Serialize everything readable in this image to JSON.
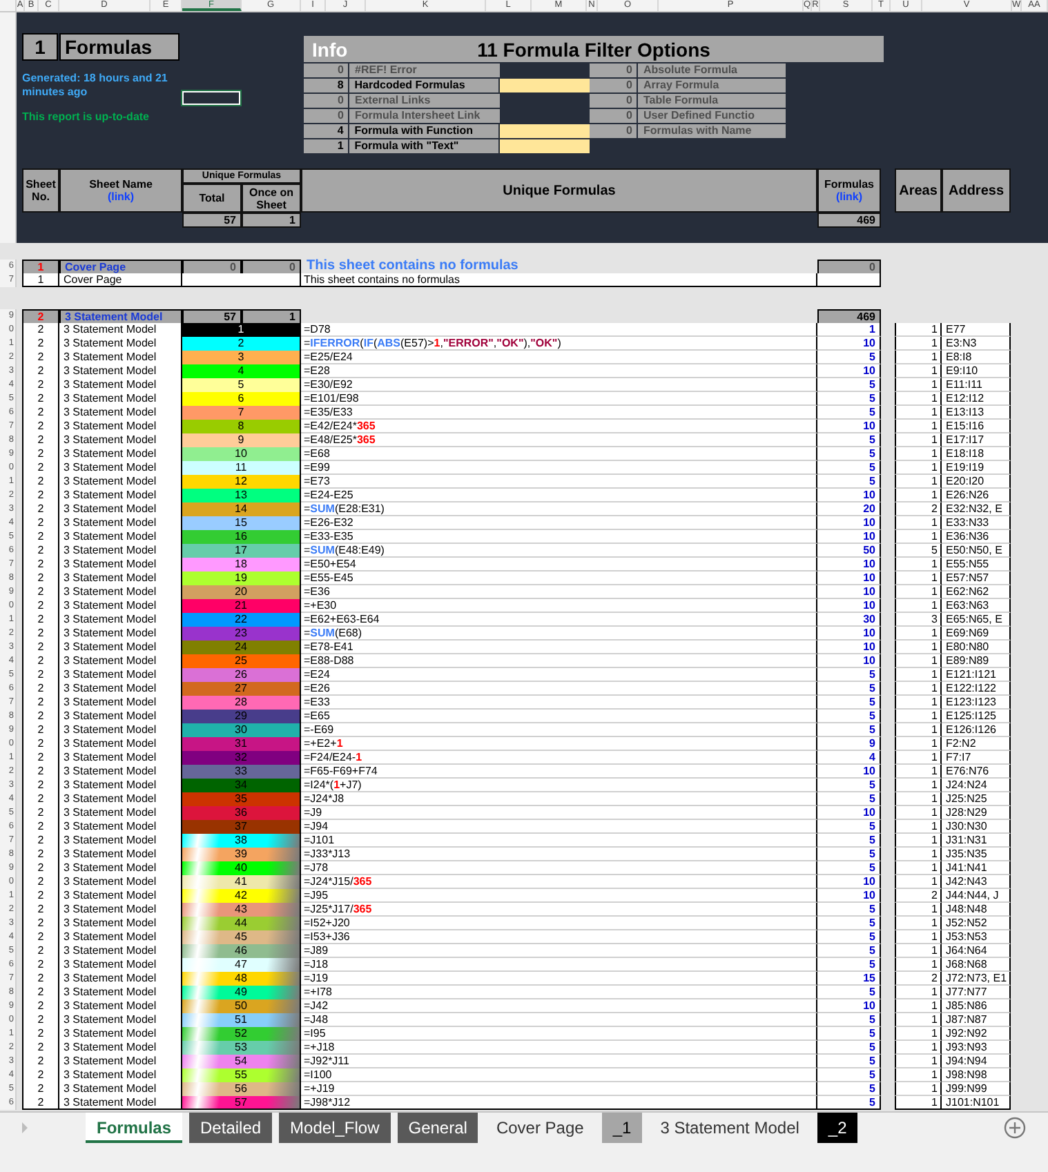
{
  "column_headers": [
    {
      "label": "A",
      "selected": false
    },
    {
      "label": "B",
      "selected": false
    },
    {
      "label": "C",
      "selected": false
    },
    {
      "label": "D",
      "selected": false
    },
    {
      "label": "E",
      "selected": false
    },
    {
      "label": "F",
      "selected": true
    },
    {
      "label": "G",
      "selected": false
    },
    {
      "label": "I",
      "selected": false
    },
    {
      "label": "J",
      "selected": false
    },
    {
      "label": "K",
      "selected": false
    },
    {
      "label": "L",
      "selected": false
    },
    {
      "label": "M",
      "selected": false
    },
    {
      "label": "N",
      "selected": false
    },
    {
      "label": "O",
      "selected": false
    },
    {
      "label": "P",
      "selected": false
    },
    {
      "label": "Q",
      "selected": false
    },
    {
      "label": "R",
      "selected": false
    },
    {
      "label": "S",
      "selected": false
    },
    {
      "label": "T",
      "selected": false
    },
    {
      "label": "U",
      "selected": false
    },
    {
      "label": "V",
      "selected": false
    },
    {
      "label": "W",
      "selected": false
    },
    {
      "label": "AA",
      "selected": false
    }
  ],
  "title": {
    "number": "1",
    "name": "Formulas"
  },
  "generated": "Generated: 18 hours and 21 minutes ago",
  "status": "This report is up-to-date",
  "info": {
    "label": "Info",
    "title": "11 Formula Filter Options",
    "left_filters": [
      {
        "count": "0",
        "label": "#REF! Error",
        "disabled": true
      },
      {
        "count": "8",
        "label": "Hardcoded Formulas",
        "disabled": false
      },
      {
        "count": "0",
        "label": "External Links",
        "disabled": true
      },
      {
        "count": "0",
        "label": "Formula Intersheet Link",
        "disabled": true
      },
      {
        "count": "4",
        "label": "Formula with Function",
        "disabled": false
      },
      {
        "count": "1",
        "label": "Formula with \"Text\"",
        "disabled": false
      }
    ],
    "right_filters": [
      {
        "count": "0",
        "label": "Absolute Formula",
        "disabled": true
      },
      {
        "count": "0",
        "label": "Array Formula",
        "disabled": true
      },
      {
        "count": "0",
        "label": "Table Formula",
        "disabled": true
      },
      {
        "count": "0",
        "label": "User Defined Functio",
        "disabled": true
      },
      {
        "count": "0",
        "label": "Formulas with Name",
        "disabled": true
      }
    ]
  },
  "summary": {
    "sheet_no": "Sheet No.",
    "sheet_name": "Sheet Name",
    "sheet_link": "(link)",
    "unique_group": "Unique Formulas",
    "total": "Total",
    "once": "Once on Sheet",
    "unique": "Unique Formulas",
    "formulas": "Formulas",
    "formulas_link": "(link)",
    "areas": "Areas",
    "address": "Address",
    "total_value": "57",
    "once_value": "1",
    "formulas_value": "469"
  },
  "sheets": [
    {
      "row": "6",
      "number": "1",
      "name": "Cover Page",
      "total": "0",
      "once": "0",
      "has_formulas": false,
      "note": "This sheet contains no formulas",
      "formulas": "0",
      "rows": [
        {
          "row": "7",
          "number": "1",
          "name": "Cover Page",
          "formula": "This sheet contains no formulas"
        }
      ]
    },
    {
      "row": "9",
      "number": "2",
      "name": "3 Statement Model",
      "total": "57",
      "once": "1",
      "has_formulas": true,
      "formulas": "469",
      "rows": [
        {
          "row": "0",
          "number": "2",
          "name": "3 Statement Model",
          "index": "1",
          "color": "#000000",
          "kind": "solid",
          "formula": "=D78",
          "formulas": "1",
          "areas": "1",
          "address": "E77"
        },
        {
          "row": "1",
          "number": "2",
          "name": "3 Statement Model",
          "index": "2",
          "color": "#00ffff",
          "kind": "solid",
          "formula": [
            {
              "text": "=",
              "kind": "text"
            },
            {
              "text": "IFERROR",
              "kind": "function"
            },
            {
              "text": "(",
              "kind": "text"
            },
            {
              "text": "IF",
              "kind": "function"
            },
            {
              "text": "(",
              "kind": "text"
            },
            {
              "text": "ABS",
              "kind": "function"
            },
            {
              "text": "(E57)>",
              "kind": "text"
            },
            {
              "text": "1",
              "kind": "number"
            },
            {
              "text": ",",
              "kind": "text"
            },
            {
              "text": "\"ERROR\"",
              "kind": "string"
            },
            {
              "text": ",",
              "kind": "text"
            },
            {
              "text": "\"OK\"",
              "kind": "string"
            },
            {
              "text": "),",
              "kind": "text"
            },
            {
              "text": "\"OK\"",
              "kind": "string"
            },
            {
              "text": ")",
              "kind": "text"
            }
          ],
          "formulas": "10",
          "areas": "1",
          "address": "E3:N3"
        },
        {
          "row": "2",
          "number": "2",
          "name": "3 Statement Model",
          "index": "3",
          "color": "#ffb04f",
          "kind": "solid",
          "formula": "=E25/E24",
          "formulas": "5",
          "areas": "1",
          "address": "E8:I8"
        },
        {
          "row": "3",
          "number": "2",
          "name": "3 Statement Model",
          "index": "4",
          "color": "#00ff00",
          "kind": "solid",
          "formula": "=E28",
          "formulas": "10",
          "areas": "1",
          "address": "E9:I10"
        },
        {
          "row": "4",
          "number": "2",
          "name": "3 Statement Model",
          "index": "5",
          "color": "#ffff99",
          "kind": "solid",
          "formula": "=E30/E92",
          "formulas": "5",
          "areas": "1",
          "address": "E11:I11"
        },
        {
          "row": "5",
          "number": "2",
          "name": "3 Statement Model",
          "index": "6",
          "color": "#ffff00",
          "kind": "solid",
          "formula": "=E101/E98",
          "formulas": "5",
          "areas": "1",
          "address": "E12:I12"
        },
        {
          "row": "6",
          "number": "2",
          "name": "3 Statement Model",
          "index": "7",
          "color": "#ff9966",
          "kind": "solid",
          "formula": "=E35/E33",
          "formulas": "5",
          "areas": "1",
          "address": "E13:I13"
        },
        {
          "row": "7",
          "number": "2",
          "name": "3 Statement Model",
          "index": "8",
          "color": "#99cc00",
          "kind": "solid",
          "formula": [
            {
              "text": "=E42/E24*",
              "kind": "text"
            },
            {
              "text": "365",
              "kind": "number"
            }
          ],
          "formulas": "10",
          "areas": "1",
          "address": "E15:I16"
        },
        {
          "row": "8",
          "number": "2",
          "name": "3 Statement Model",
          "index": "9",
          "color": "#ffcc99",
          "kind": "solid",
          "formula": [
            {
              "text": "=E48/E25*",
              "kind": "text"
            },
            {
              "text": "365",
              "kind": "number"
            }
          ],
          "formulas": "5",
          "areas": "1",
          "address": "E17:I17"
        },
        {
          "row": "9",
          "number": "2",
          "name": "3 Statement Model",
          "index": "10",
          "color": "#90ee90",
          "kind": "solid",
          "formula": "=E68",
          "formulas": "5",
          "areas": "1",
          "address": "E18:I18"
        },
        {
          "row": "0",
          "number": "2",
          "name": "3 Statement Model",
          "index": "11",
          "color": "#ccffff",
          "kind": "solid",
          "formula": "=E99",
          "formulas": "5",
          "areas": "1",
          "address": "E19:I19"
        },
        {
          "row": "1",
          "number": "2",
          "name": "3 Statement Model",
          "index": "12",
          "color": "#ffd700",
          "kind": "solid",
          "formula": "=E73",
          "formulas": "5",
          "areas": "1",
          "address": "E20:I20"
        },
        {
          "row": "2",
          "number": "2",
          "name": "3 Statement Model",
          "index": "13",
          "color": "#00ff80",
          "kind": "solid",
          "formula": "=E24-E25",
          "formulas": "10",
          "areas": "1",
          "address": "E26:N26"
        },
        {
          "row": "3",
          "number": "2",
          "name": "3 Statement Model",
          "index": "14",
          "color": "#daa520",
          "kind": "solid",
          "formula": [
            {
              "text": "=",
              "kind": "text"
            },
            {
              "text": "SUM",
              "kind": "function"
            },
            {
              "text": "(E28:E31)",
              "kind": "text"
            }
          ],
          "formulas": "20",
          "areas": "2",
          "address": "E32:N32, E"
        },
        {
          "row": "4",
          "number": "2",
          "name": "3 Statement Model",
          "index": "15",
          "color": "#99ccff",
          "kind": "solid",
          "formula": "=E26-E32",
          "formulas": "10",
          "areas": "1",
          "address": "E33:N33"
        },
        {
          "row": "5",
          "number": "2",
          "name": "3 Statement Model",
          "index": "16",
          "color": "#33cc33",
          "kind": "solid",
          "formula": "=E33-E35",
          "formulas": "10",
          "areas": "1",
          "address": "E36:N36"
        },
        {
          "row": "6",
          "number": "2",
          "name": "3 Statement Model",
          "index": "17",
          "color": "#66cdaa",
          "kind": "solid",
          "formula": [
            {
              "text": "=",
              "kind": "text"
            },
            {
              "text": "SUM",
              "kind": "function"
            },
            {
              "text": "(E48:E49)",
              "kind": "text"
            }
          ],
          "formulas": "50",
          "areas": "5",
          "address": "E50:N50, E"
        },
        {
          "row": "7",
          "number": "2",
          "name": "3 Statement Model",
          "index": "18",
          "color": "#ff99ff",
          "kind": "solid",
          "formula": "=E50+E54",
          "formulas": "10",
          "areas": "1",
          "address": "E55:N55"
        },
        {
          "row": "8",
          "number": "2",
          "name": "3 Statement Model",
          "index": "19",
          "color": "#adff2f",
          "kind": "solid",
          "formula": "=E55-E45",
          "formulas": "10",
          "areas": "1",
          "address": "E57:N57"
        },
        {
          "row": "9",
          "number": "2",
          "name": "3 Statement Model",
          "index": "20",
          "color": "#d2a060",
          "kind": "solid",
          "formula": "=E36",
          "formulas": "10",
          "areas": "1",
          "address": "E62:N62"
        },
        {
          "row": "0",
          "number": "2",
          "name": "3 Statement Model",
          "index": "21",
          "color": "#ff0066",
          "kind": "solid",
          "formula": "=+E30",
          "formulas": "10",
          "areas": "1",
          "address": "E63:N63"
        },
        {
          "row": "1",
          "number": "2",
          "name": "3 Statement Model",
          "index": "22",
          "color": "#0099ff",
          "kind": "solid",
          "formula": "=E62+E63-E64",
          "formulas": "30",
          "areas": "3",
          "address": "E65:N65, E"
        },
        {
          "row": "2",
          "number": "2",
          "name": "3 Statement Model",
          "index": "23",
          "color": "#9933cc",
          "kind": "solid",
          "formula": [
            {
              "text": "=",
              "kind": "text"
            },
            {
              "text": "SUM",
              "kind": "function"
            },
            {
              "text": "(E68)",
              "kind": "text"
            }
          ],
          "formulas": "10",
          "areas": "1",
          "address": "E69:N69"
        },
        {
          "row": "3",
          "number": "2",
          "name": "3 Statement Model",
          "index": "24",
          "color": "#808000",
          "kind": "solid",
          "formula": "=E78-E41",
          "formulas": "10",
          "areas": "1",
          "address": "E80:N80"
        },
        {
          "row": "4",
          "number": "2",
          "name": "3 Statement Model",
          "index": "25",
          "color": "#ff6600",
          "kind": "solid",
          "formula": "=E88-D88",
          "formulas": "10",
          "areas": "1",
          "address": "E89:N89"
        },
        {
          "row": "5",
          "number": "2",
          "name": "3 Statement Model",
          "index": "26",
          "color": "#da70d6",
          "kind": "solid",
          "formula": "=E24",
          "formulas": "5",
          "areas": "1",
          "address": "E121:I121"
        },
        {
          "row": "6",
          "number": "2",
          "name": "3 Statement Model",
          "index": "27",
          "color": "#d2691e",
          "kind": "solid",
          "formula": "=E26",
          "formulas": "5",
          "areas": "1",
          "address": "E122:I122"
        },
        {
          "row": "7",
          "number": "2",
          "name": "3 Statement Model",
          "index": "28",
          "color": "#ff69b4",
          "kind": "solid",
          "formula": "=E33",
          "formulas": "5",
          "areas": "1",
          "address": "E123:I123"
        },
        {
          "row": "8",
          "number": "2",
          "name": "3 Statement Model",
          "index": "29",
          "color": "#483d8b",
          "kind": "solid",
          "formula": "=E65",
          "formulas": "5",
          "areas": "1",
          "address": "E125:I125"
        },
        {
          "row": "9",
          "number": "2",
          "name": "3 Statement Model",
          "index": "30",
          "color": "#20b2aa",
          "kind": "solid",
          "formula": "=-E69",
          "formulas": "5",
          "areas": "1",
          "address": "E126:I126"
        },
        {
          "row": "0",
          "number": "2",
          "name": "3 Statement Model",
          "index": "31",
          "color": "#c71585",
          "kind": "solid",
          "formula": [
            {
              "text": "=+E2+",
              "kind": "text"
            },
            {
              "text": "1",
              "kind": "number"
            }
          ],
          "formulas": "9",
          "areas": "1",
          "address": "F2:N2"
        },
        {
          "row": "1",
          "number": "2",
          "name": "3 Statement Model",
          "index": "32",
          "color": "#800080",
          "kind": "solid",
          "formula": [
            {
              "text": "=F24/E24-",
              "kind": "text"
            },
            {
              "text": "1",
              "kind": "number"
            }
          ],
          "formulas": "4",
          "areas": "1",
          "address": "F7:I7"
        },
        {
          "row": "2",
          "number": "2",
          "name": "3 Statement Model",
          "index": "33",
          "color": "#666699",
          "kind": "solid",
          "formula": "=F65-F69+F74",
          "formulas": "10",
          "areas": "1",
          "address": "E76:N76"
        },
        {
          "row": "3",
          "number": "2",
          "name": "3 Statement Model",
          "index": "34",
          "color": "#006400",
          "kind": "solid",
          "formula": [
            {
              "text": "=I24*(",
              "kind": "text"
            },
            {
              "text": "1",
              "kind": "number"
            },
            {
              "text": "+J7)",
              "kind": "text"
            }
          ],
          "formulas": "5",
          "areas": "1",
          "address": "J24:N24"
        },
        {
          "row": "4",
          "number": "2",
          "name": "3 Statement Model",
          "index": "35",
          "color": "#cc3300",
          "kind": "solid",
          "formula": "=J24*J8",
          "formulas": "5",
          "areas": "1",
          "address": "J25:N25"
        },
        {
          "row": "5",
          "number": "2",
          "name": "3 Statement Model",
          "index": "36",
          "color": "#dc143c",
          "kind": "solid",
          "formula": "=J9",
          "formulas": "10",
          "areas": "1",
          "address": "J28:N29"
        },
        {
          "row": "6",
          "number": "2",
          "name": "3 Statement Model",
          "index": "37",
          "color": "#993300",
          "kind": "solid",
          "formula": "=J94",
          "formulas": "5",
          "areas": "1",
          "address": "J30:N30"
        },
        {
          "row": "7",
          "number": "2",
          "name": "3 Statement Model",
          "index": "38",
          "color": "#00ffff",
          "kind": "gradient",
          "formula": "=J101",
          "formulas": "5",
          "areas": "1",
          "address": "J31:N31"
        },
        {
          "row": "8",
          "number": "2",
          "name": "3 Statement Model",
          "index": "39",
          "color": "#f4a460",
          "kind": "gradient",
          "formula": "=J33*J13",
          "formulas": "5",
          "areas": "1",
          "address": "J35:N35"
        },
        {
          "row": "9",
          "number": "2",
          "name": "3 Statement Model",
          "index": "40",
          "color": "#00ff00",
          "kind": "gradient",
          "formula": "=J78",
          "formulas": "5",
          "areas": "1",
          "address": "J41:N41"
        },
        {
          "row": "0",
          "number": "2",
          "name": "3 Statement Model",
          "index": "41",
          "color": "#eee8aa",
          "kind": "gradient",
          "formula": [
            {
              "text": "=J24*J15/",
              "kind": "text"
            },
            {
              "text": "365",
              "kind": "number"
            }
          ],
          "formulas": "10",
          "areas": "1",
          "address": "J42:N43"
        },
        {
          "row": "1",
          "number": "2",
          "name": "3 Statement Model",
          "index": "42",
          "color": "#ffff00",
          "kind": "gradient",
          "formula": "=J95",
          "formulas": "10",
          "areas": "2",
          "address": "J44:N44, J"
        },
        {
          "row": "2",
          "number": "2",
          "name": "3 Statement Model",
          "index": "43",
          "color": "#e9967a",
          "kind": "gradient",
          "formula": [
            {
              "text": "=J25*J17/",
              "kind": "text"
            },
            {
              "text": "365",
              "kind": "number"
            }
          ],
          "formulas": "5",
          "areas": "1",
          "address": "J48:N48"
        },
        {
          "row": "3",
          "number": "2",
          "name": "3 Statement Model",
          "index": "44",
          "color": "#9acd32",
          "kind": "gradient",
          "formula": "=I52+J20",
          "formulas": "5",
          "areas": "1",
          "address": "J52:N52"
        },
        {
          "row": "4",
          "number": "2",
          "name": "3 Statement Model",
          "index": "45",
          "color": "#deb887",
          "kind": "gradient",
          "formula": "=I53+J36",
          "formulas": "5",
          "areas": "1",
          "address": "J53:N53"
        },
        {
          "row": "5",
          "number": "2",
          "name": "3 Statement Model",
          "index": "46",
          "color": "#8fbc8f",
          "kind": "gradient",
          "formula": "=J89",
          "formulas": "5",
          "areas": "1",
          "address": "J64:N64"
        },
        {
          "row": "6",
          "number": "2",
          "name": "3 Statement Model",
          "index": "47",
          "color": "#e0ffff",
          "kind": "gradient",
          "formula": "=J18",
          "formulas": "5",
          "areas": "1",
          "address": "J68:N68"
        },
        {
          "row": "7",
          "number": "2",
          "name": "3 Statement Model",
          "index": "48",
          "color": "#ffd700",
          "kind": "gradient",
          "formula": "=J19",
          "formulas": "15",
          "areas": "2",
          "address": "J72:N73, E1"
        },
        {
          "row": "8",
          "number": "2",
          "name": "3 Statement Model",
          "index": "49",
          "color": "#00fa9a",
          "kind": "gradient",
          "formula": "=+I78",
          "formulas": "5",
          "areas": "1",
          "address": "J77:N77"
        },
        {
          "row": "9",
          "number": "2",
          "name": "3 Statement Model",
          "index": "50",
          "color": "#daa520",
          "kind": "gradient",
          "formula": "=J42",
          "formulas": "10",
          "areas": "1",
          "address": "J85:N86"
        },
        {
          "row": "0",
          "number": "2",
          "name": "3 Statement Model",
          "index": "51",
          "color": "#87cefa",
          "kind": "gradient",
          "formula": "=J48",
          "formulas": "5",
          "areas": "1",
          "address": "J87:N87"
        },
        {
          "row": "1",
          "number": "2",
          "name": "3 Statement Model",
          "index": "52",
          "color": "#32cd32",
          "kind": "gradient",
          "formula": "=I95",
          "formulas": "5",
          "areas": "1",
          "address": "J92:N92"
        },
        {
          "row": "2",
          "number": "2",
          "name": "3 Statement Model",
          "index": "53",
          "color": "#66cdaa",
          "kind": "gradient",
          "formula": "=+J18",
          "formulas": "5",
          "areas": "1",
          "address": "J93:N93"
        },
        {
          "row": "3",
          "number": "2",
          "name": "3 Statement Model",
          "index": "54",
          "color": "#ee82ee",
          "kind": "gradient",
          "formula": "=J92*J11",
          "formulas": "5",
          "areas": "1",
          "address": "J94:N94"
        },
        {
          "row": "4",
          "number": "2",
          "name": "3 Statement Model",
          "index": "55",
          "color": "#adff2f",
          "kind": "gradient",
          "formula": "=I100",
          "formulas": "5",
          "areas": "1",
          "address": "J98:N98"
        },
        {
          "row": "5",
          "number": "2",
          "name": "3 Statement Model",
          "index": "56",
          "color": "#deb887",
          "kind": "gradient",
          "formula": "=+J19",
          "formulas": "5",
          "areas": "1",
          "address": "J99:N99"
        },
        {
          "row": "6",
          "number": "2",
          "name": "3 Statement Model",
          "index": "57",
          "color": "#ff1493",
          "kind": "gradient",
          "formula": "=J98*J12",
          "formulas": "5",
          "areas": "1",
          "address": "J101:N101"
        }
      ]
    }
  ],
  "tabs": [
    {
      "label": "Formulas",
      "selected": true
    },
    {
      "label": "Detailed",
      "selected": false,
      "color": "#595959"
    },
    {
      "label": "Model_Flow",
      "selected": false,
      "color": "#595959"
    },
    {
      "label": "General",
      "selected": false,
      "color": "#595959"
    },
    {
      "label": "Cover Page",
      "selected": false
    },
    {
      "label": "_1",
      "selected": false,
      "color": "#a6a6a6"
    },
    {
      "label": "3 Statement Model",
      "selected": false
    },
    {
      "label": "_2",
      "selected": false,
      "color": "#000000"
    }
  ]
}
